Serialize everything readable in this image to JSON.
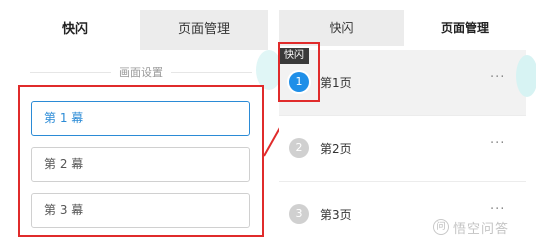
{
  "left_panel": {
    "tabs": [
      {
        "label": "快闪"
      },
      {
        "label": "页面管理"
      }
    ],
    "section_title": "画面设置",
    "scenes": [
      {
        "label": "第 1 幕"
      },
      {
        "label": "第 2 幕"
      },
      {
        "label": "第 3 幕"
      }
    ]
  },
  "right_panel": {
    "tabs": [
      {
        "label": "快闪"
      },
      {
        "label": "页面管理"
      }
    ],
    "badge": "快闪",
    "pages": [
      {
        "number": "1",
        "label": "第1页",
        "more": "···"
      },
      {
        "number": "2",
        "label": "第2页",
        "more": "···"
      },
      {
        "number": "3",
        "label": "第3页",
        "more": "···"
      }
    ]
  },
  "watermark": {
    "logo_text": "问",
    "text": "悟空问答"
  },
  "colors": {
    "highlight_red": "#e02b2b",
    "selected_blue": "#2b8bd6",
    "active_circle": "#1f8fe8"
  }
}
